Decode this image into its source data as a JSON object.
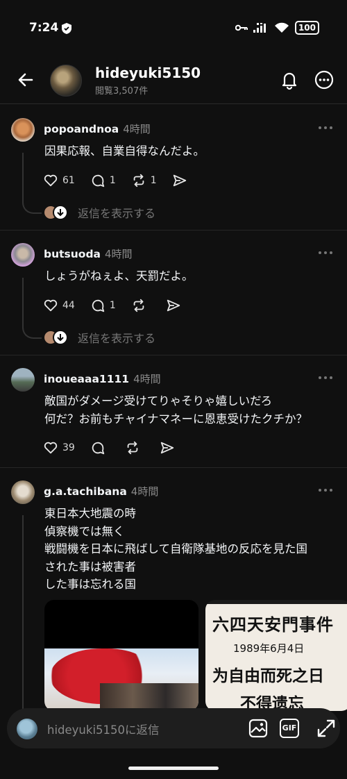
{
  "status_bar": {
    "time": "7:24",
    "battery": "100"
  },
  "header": {
    "username": "hideyuki5150",
    "views": "閲覧3,507件"
  },
  "posts": [
    {
      "username": "popoandnoa",
      "time": "4時間",
      "lines": [
        "因果応報、自業自得なんだよ。"
      ],
      "likes": "61",
      "comments": "1",
      "reposts": "1",
      "replies_label": "返信を表示する"
    },
    {
      "username": "butsuoda",
      "time": "4時間",
      "lines": [
        "しょうがねぇよ、天罰だよ。"
      ],
      "likes": "44",
      "comments": "1",
      "reposts": "",
      "replies_label": "返信を表示する"
    },
    {
      "username": "inoueaaa1111",
      "time": "4時間",
      "lines": [
        "敵国がダメージ受けてりゃそりゃ嬉しいだろ",
        "何だ？お前もチャイナマネーに恩恵受けたクチか？"
      ],
      "likes": "39",
      "comments": "",
      "reposts": ""
    },
    {
      "username": "g.a.tachibana",
      "time": "4時間",
      "lines": [
        "東日本大地震の時",
        "偵察機では無く",
        "戦闘機を日本に飛ばして自衛隊基地の反応を見た国",
        "された事は被害者",
        "した事は忘れる国"
      ],
      "image2_lines": [
        "六四天安門事件",
        "1989年6月4日",
        "为自由而死之日",
        "不得遗忘"
      ]
    }
  ],
  "composer": {
    "placeholder": "hideyuki5150に返信",
    "gif_label": "GIF"
  },
  "icons": [
    "back-arrow-icon",
    "bell-icon",
    "more-icon",
    "heart-icon",
    "comment-icon",
    "repost-icon",
    "share-icon",
    "image-icon",
    "gif-icon",
    "expand-icon"
  ]
}
